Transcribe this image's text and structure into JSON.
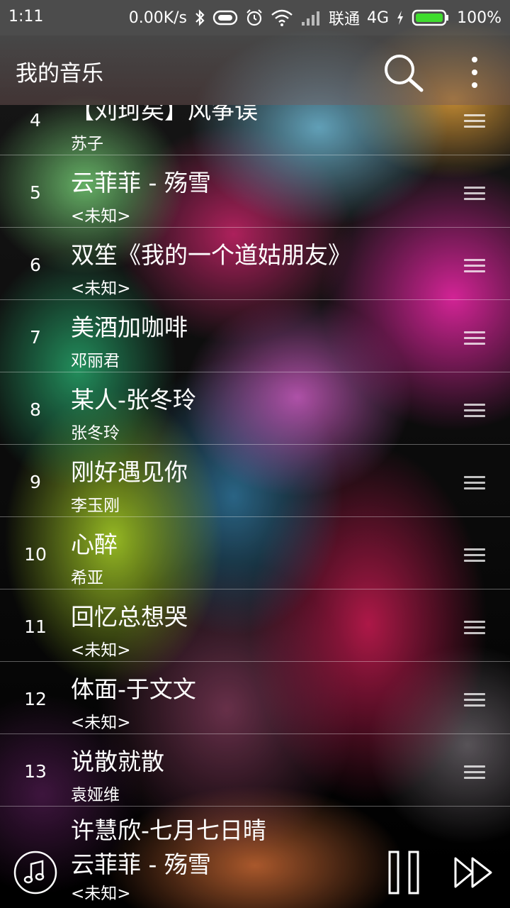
{
  "status_bar": {
    "time": "1:11",
    "net_speed": "0.00K/s",
    "carrier": "联通",
    "network": "4G",
    "battery": "100%",
    "icons": [
      "bluetooth-icon",
      "vibrate-icon",
      "alarm-icon",
      "wifi-icon",
      "signal-icon",
      "charging-icon",
      "battery-icon"
    ]
  },
  "app_bar": {
    "title": "我的音乐",
    "search_icon": "search-icon",
    "more_icon": "more-vert-icon"
  },
  "songs": [
    {
      "num": "4",
      "title": "【刘珂矣】风筝误",
      "artist": "苏子"
    },
    {
      "num": "5",
      "title": "云菲菲 - 殇雪",
      "artist": "<未知>"
    },
    {
      "num": "6",
      "title": "双笙《我的一个道姑朋友》",
      "artist": "<未知>"
    },
    {
      "num": "7",
      "title": "美酒加咖啡",
      "artist": "邓丽君"
    },
    {
      "num": "8",
      "title": "某人-张冬玲",
      "artist": "张冬玲"
    },
    {
      "num": "9",
      "title": "刚好遇见你",
      "artist": "李玉刚"
    },
    {
      "num": "10",
      "title": "心醉",
      "artist": "希亚"
    },
    {
      "num": "11",
      "title": "回忆总想哭",
      "artist": "<未知>"
    },
    {
      "num": "12",
      "title": "体面-于文文",
      "artist": "<未知>"
    },
    {
      "num": "13",
      "title": "说散就散",
      "artist": "袁娅维"
    }
  ],
  "next_preview": "许慧欣-七月七日晴",
  "player": {
    "title": "云菲菲 - 殇雪",
    "artist": "<未知>",
    "disc_icon": "music-note-icon",
    "pause_icon": "pause-icon",
    "next_icon": "skip-next-icon"
  }
}
